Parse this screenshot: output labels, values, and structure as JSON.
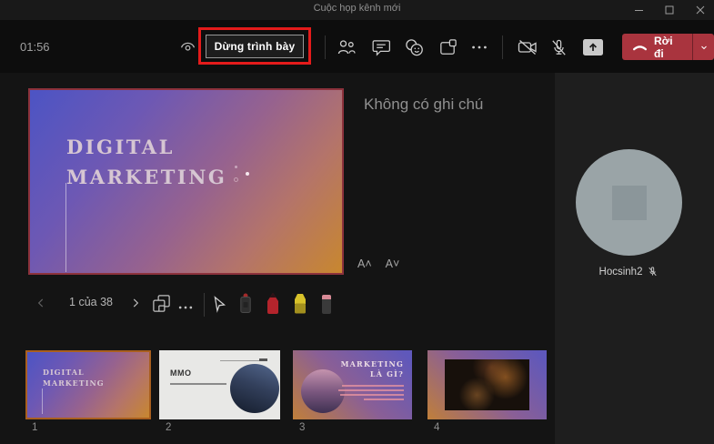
{
  "window": {
    "title": "Cuộc họp kênh mới",
    "controls": [
      "minimize",
      "maximize",
      "close"
    ]
  },
  "toolbar": {
    "timer": "01:56",
    "stop_presenting_label": "Dừng trình bày",
    "leave_label": "Rời đi",
    "icons": [
      "presenter-eye",
      "people",
      "chat",
      "reactions",
      "breakout-rooms",
      "more",
      "camera-off",
      "mic-off",
      "share-tray",
      "hang-up",
      "chevron-down"
    ]
  },
  "stage": {
    "notes_text": "Không có ghi chú",
    "slide": {
      "title_line1": "DIGITAL",
      "title_line2": "MARKETING"
    },
    "font_larger": "A˄",
    "font_smaller": "A˅"
  },
  "slide_nav": {
    "counter": "1 của 38",
    "tools": [
      "previous-slide",
      "next-slide",
      "grid-view",
      "more",
      "cursor",
      "laser-pointer",
      "red-pen",
      "highlighter",
      "eraser"
    ]
  },
  "participant": {
    "name": "Hocsinh2",
    "muted": true
  },
  "thumbnails": [
    {
      "number": "1",
      "title_line1": "DIGITAL",
      "title_line2": "MARKETING",
      "selected": true
    },
    {
      "number": "2",
      "title": "MMO"
    },
    {
      "number": "3",
      "title_line1": "MARKETING",
      "title_line2": "LÀ GÌ?"
    },
    {
      "number": "4"
    }
  ],
  "colors": {
    "annotation_red": "#e41b1b",
    "leave_button": "#a9343e",
    "selected_thumb_border": "#a95f1f",
    "slide_gradient": [
      "#4c54c4",
      "#96628f",
      "#c8872f"
    ],
    "avatar_grey": "#9aa4a7"
  }
}
